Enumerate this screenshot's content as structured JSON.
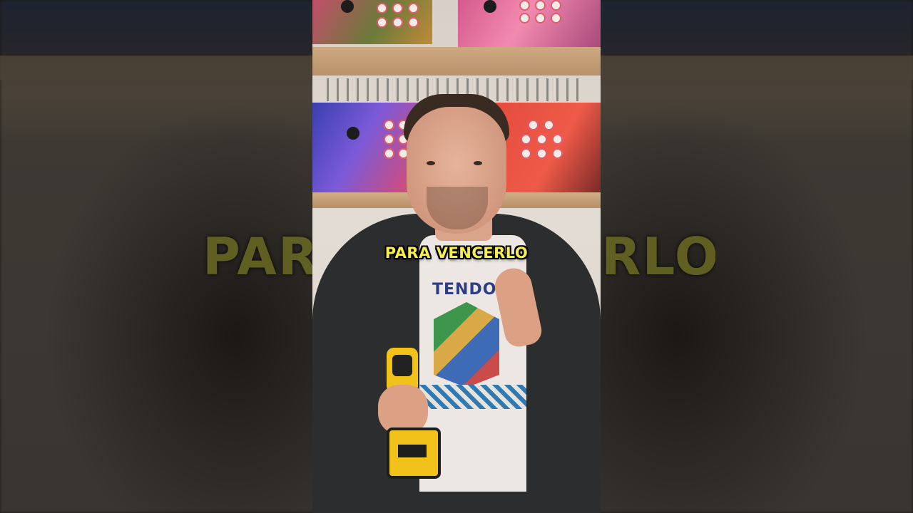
{
  "video": {
    "caption": "PARA VENCERLO",
    "shirt_text": "TENDO"
  },
  "background": {
    "caption_left_fragment": "PAR",
    "caption_right_fragment": "RLO"
  },
  "colors": {
    "caption_fill": "#f9ef4a",
    "caption_outline": "#000000",
    "jacket": "#2c2d2e",
    "drill": "#f1c21a"
  }
}
